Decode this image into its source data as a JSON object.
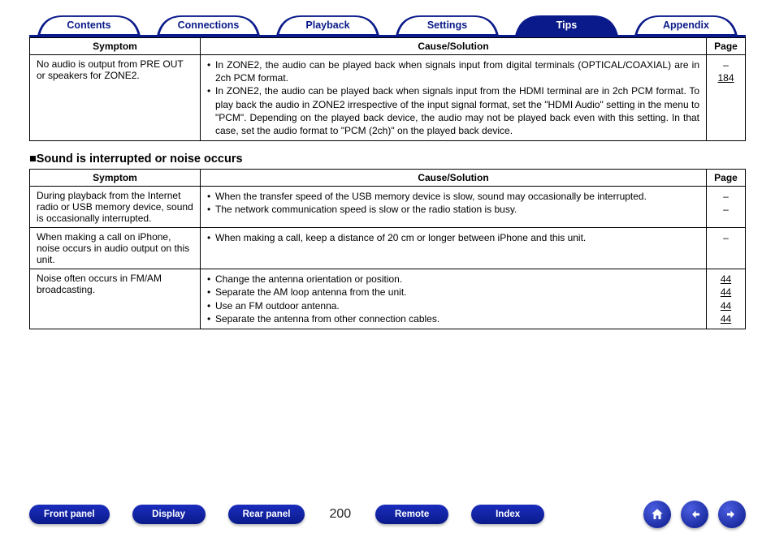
{
  "tabs": [
    "Contents",
    "Connections",
    "Playback",
    "Settings",
    "Tips",
    "Appendix"
  ],
  "activeTab": 4,
  "table1": {
    "headers": [
      "Symptom",
      "Cause/Solution",
      "Page"
    ],
    "rows": [
      {
        "symptom": "No audio is output from PRE OUT or speakers for ZONE2.",
        "causes": [
          "In ZONE2, the audio can be played back when signals input from digital terminals (OPTICAL/COAXIAL) are in 2ch PCM format.",
          "In ZONE2, the audio can be played back when signals input from the HDMI terminal are in 2ch PCM format. To play back the audio in ZONE2 irrespective of the input signal format, set the \"HDMI Audio\" setting in the menu to \"PCM\". Depending on the played back device, the audio may not be played back even with this setting. In that case, set the audio format to \"PCM (2ch)\" on the played back device."
        ],
        "pages": [
          "–",
          "184"
        ],
        "pageLinks": [
          false,
          true
        ]
      }
    ]
  },
  "section2": {
    "marker": "■",
    "title": "Sound is interrupted or noise occurs"
  },
  "table2": {
    "headers": [
      "Symptom",
      "Cause/Solution",
      "Page"
    ],
    "rows": [
      {
        "symptom": "During playback from the Internet radio or USB memory device, sound is occasionally interrupted.",
        "causes": [
          "When the transfer speed of the USB memory device is slow, sound may occasionally be interrupted.",
          "The network communication speed is slow or the radio station is busy."
        ],
        "pages": [
          "–",
          "–"
        ],
        "pageLinks": [
          false,
          false
        ]
      },
      {
        "symptom": "When making a call on iPhone, noise occurs in audio output on this unit.",
        "causes": [
          "When making a call, keep a distance of 20 cm or longer between iPhone and this unit."
        ],
        "pages": [
          "–"
        ],
        "pageLinks": [
          false
        ]
      },
      {
        "symptom": "Noise often occurs in FM/AM broadcasting.",
        "causes": [
          "Change the antenna orientation or position.",
          "Separate the AM loop antenna from the unit.",
          "Use an FM outdoor antenna.",
          "Separate the antenna from other connection cables."
        ],
        "pages": [
          "44",
          "44",
          "44",
          "44"
        ],
        "pageLinks": [
          true,
          true,
          true,
          true
        ]
      }
    ]
  },
  "footer": {
    "buttons": [
      "Front panel",
      "Display",
      "Rear panel",
      "Remote",
      "Index"
    ],
    "pageNumber": "200"
  }
}
